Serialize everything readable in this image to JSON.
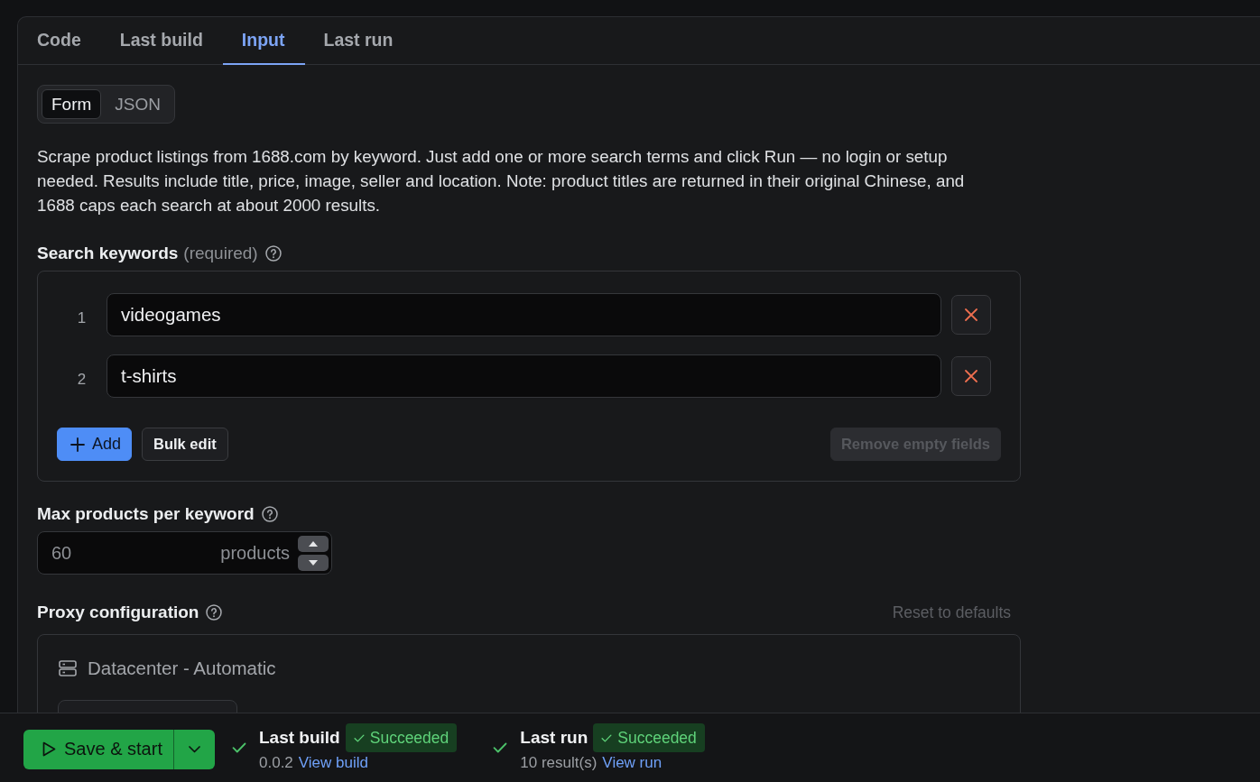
{
  "tabs": [
    {
      "label": "Code",
      "selected": false
    },
    {
      "label": "Last build",
      "selected": false
    },
    {
      "label": "Input",
      "selected": true
    },
    {
      "label": "Last run",
      "selected": false
    }
  ],
  "view_toggle": [
    {
      "label": "Form",
      "selected": true
    },
    {
      "label": "JSON",
      "selected": false
    }
  ],
  "description": "Scrape product listings from 1688.com by keyword. Just add one or more search terms and click Run — no login or setup needed. Results include title, price, image, seller and location. Note: product titles are returned in their original Chinese, and 1688 caps each search at about 2000 results.",
  "search_keywords": {
    "label": "Search keywords",
    "hint": "(required)",
    "items": [
      {
        "number": "1",
        "value": "videogames"
      },
      {
        "number": "2",
        "value": "t-shirts"
      }
    ],
    "buttons": [
      {
        "label": "Add",
        "kind": "primary"
      },
      {
        "label": "Bulk edit",
        "kind": "secondary"
      }
    ],
    "remove_empty": {
      "label": "Remove empty fields",
      "disabled": true
    }
  },
  "max_products": {
    "label": "Max products per keyword",
    "placeholder": "60",
    "unit": "products"
  },
  "proxy": {
    "label": "Proxy configuration",
    "reset": {
      "label": "Reset to defaults",
      "disabled": true
    },
    "option": "Datacenter - Automatic"
  },
  "footer": {
    "primary_button": "Save & start",
    "statuses": [
      {
        "title": "Last build",
        "badge": "Succeeded",
        "detail": "0.0.2",
        "link": "View build"
      },
      {
        "title": "Last run",
        "badge": "Succeeded",
        "detail": "10 result(s)",
        "link": "View run"
      }
    ]
  }
}
